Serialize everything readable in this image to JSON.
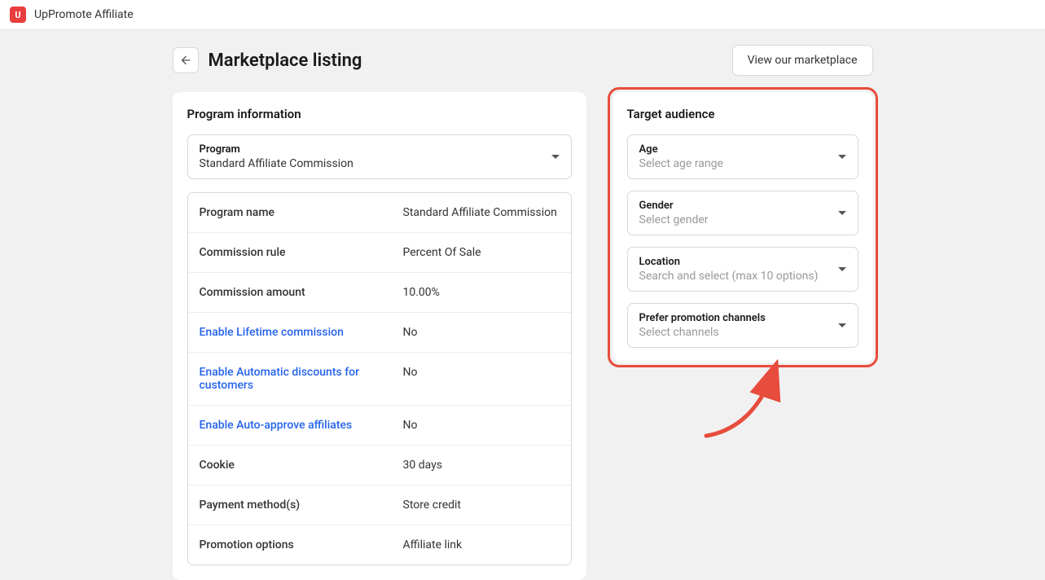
{
  "app": {
    "name": "UpPromote Affiliate"
  },
  "page": {
    "title": "Marketplace listing",
    "view_marketplace_btn": "View our marketplace"
  },
  "program_info": {
    "title": "Program information",
    "program_label": "Program",
    "program_value": "Standard Affiliate Commission",
    "rows": [
      {
        "label": "Program name",
        "value": "Standard Affiliate Commission",
        "link": false
      },
      {
        "label": "Commission rule",
        "value": "Percent Of Sale",
        "link": false
      },
      {
        "label": "Commission amount",
        "value": "10.00%",
        "link": false
      },
      {
        "label": "Enable Lifetime commission",
        "value": "No",
        "link": true
      },
      {
        "label": "Enable Automatic discounts for customers",
        "value": "No",
        "link": true
      },
      {
        "label": "Enable Auto-approve affiliates",
        "value": "No",
        "link": true
      },
      {
        "label": "Cookie",
        "value": "30 days",
        "link": false
      },
      {
        "label": "Payment method(s)",
        "value": "Store credit",
        "link": false
      },
      {
        "label": "Promotion options",
        "value": "Affiliate link",
        "link": false
      }
    ]
  },
  "target_audience": {
    "title": "Target audience",
    "fields": [
      {
        "label": "Age",
        "placeholder": "Select age range"
      },
      {
        "label": "Gender",
        "placeholder": "Select gender"
      },
      {
        "label": "Location",
        "placeholder": "Search and select (max 10 options)"
      },
      {
        "label": "Prefer promotion channels",
        "placeholder": "Select channels"
      }
    ]
  }
}
